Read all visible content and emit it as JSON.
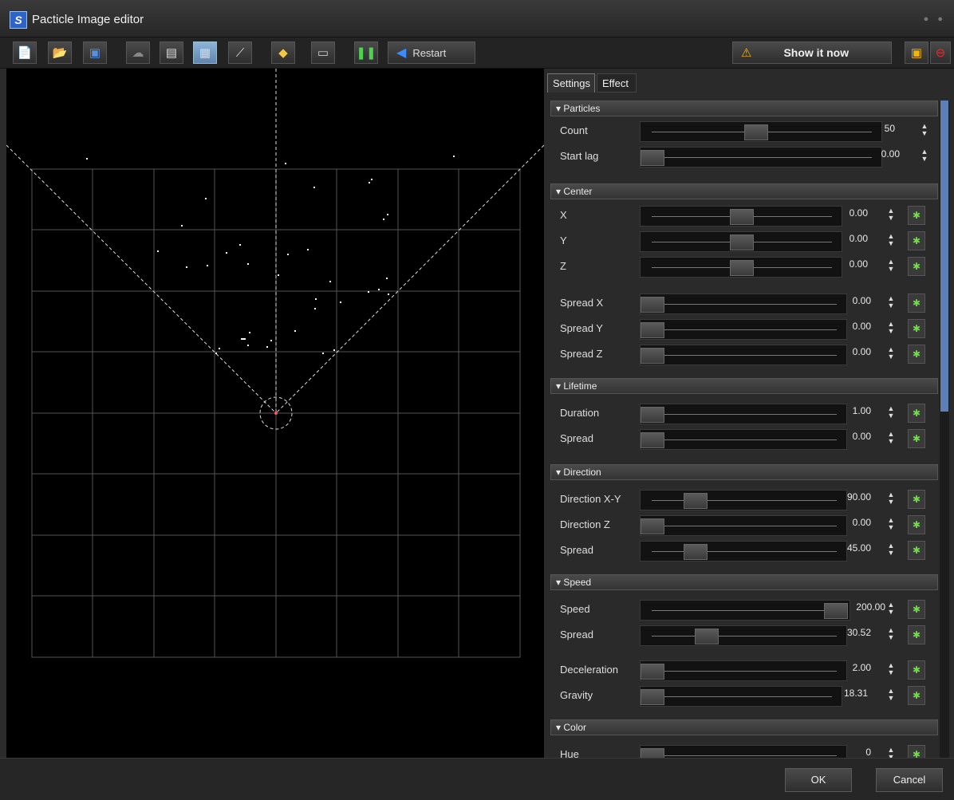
{
  "window": {
    "title": "Pacticle Image editor"
  },
  "toolbar": {
    "restart_label": "Restart",
    "show_now_label": "Show it now",
    "icons": [
      "new-file-icon",
      "open-folder-icon",
      "save-icon",
      "cloud-icon",
      "clapperboard-icon",
      "grid-icon",
      "line-icon",
      "eraser-icon",
      "image-icon",
      "pause-icon",
      "restart-icon",
      "warning-icon",
      "save-blue-icon",
      "stop-icon"
    ]
  },
  "tabs": [
    {
      "label": "Settings"
    },
    {
      "label": "Effect"
    }
  ],
  "sections": [
    {
      "title": "Particles",
      "rows": [
        {
          "label": "Count",
          "value": "50"
        },
        {
          "label": "Start lag",
          "value": "0.00"
        }
      ]
    },
    {
      "title": "Center",
      "rows": [
        {
          "label": "X",
          "value": "0.00"
        },
        {
          "label": "Y",
          "value": "0.00"
        },
        {
          "label": "Z",
          "value": "0.00"
        },
        {
          "label": "Spread X",
          "value": "0.00"
        },
        {
          "label": "Spread Y",
          "value": "0.00"
        },
        {
          "label": "Spread Z",
          "value": "0.00"
        }
      ]
    },
    {
      "title": "Lifetime",
      "rows": [
        {
          "label": "Duration",
          "value": "1.00"
        },
        {
          "label": "Spread",
          "value": "0.00"
        }
      ]
    },
    {
      "title": "Direction",
      "rows": [
        {
          "label": "Direction X-Y",
          "value": "90.00"
        },
        {
          "label": "Direction Z",
          "value": "0.00"
        },
        {
          "label": "Spread",
          "value": "45.00"
        }
      ]
    },
    {
      "title": "Speed",
      "rows": [
        {
          "label": "Speed",
          "value": "200.00"
        },
        {
          "label": "Spread",
          "value": "30.52"
        },
        {
          "label": "Deceleration",
          "value": "2.00"
        },
        {
          "label": "Gravity",
          "value": "18.31"
        }
      ]
    },
    {
      "title": "Color",
      "rows": [
        {
          "label": "Hue",
          "value": "0"
        }
      ]
    }
  ],
  "footer": {
    "ok_label": "OK",
    "cancel_label": "Cancel"
  }
}
